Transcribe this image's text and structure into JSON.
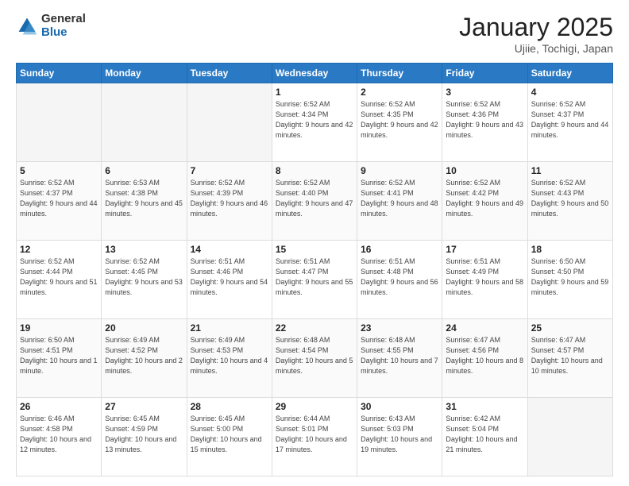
{
  "logo": {
    "general": "General",
    "blue": "Blue"
  },
  "header": {
    "month": "January 2025",
    "location": "Ujiie, Tochigi, Japan"
  },
  "weekdays": [
    "Sunday",
    "Monday",
    "Tuesday",
    "Wednesday",
    "Thursday",
    "Friday",
    "Saturday"
  ],
  "weeks": [
    [
      {
        "day": "",
        "info": ""
      },
      {
        "day": "",
        "info": ""
      },
      {
        "day": "",
        "info": ""
      },
      {
        "day": "1",
        "info": "Sunrise: 6:52 AM\nSunset: 4:34 PM\nDaylight: 9 hours and 42 minutes."
      },
      {
        "day": "2",
        "info": "Sunrise: 6:52 AM\nSunset: 4:35 PM\nDaylight: 9 hours and 42 minutes."
      },
      {
        "day": "3",
        "info": "Sunrise: 6:52 AM\nSunset: 4:36 PM\nDaylight: 9 hours and 43 minutes."
      },
      {
        "day": "4",
        "info": "Sunrise: 6:52 AM\nSunset: 4:37 PM\nDaylight: 9 hours and 44 minutes."
      }
    ],
    [
      {
        "day": "5",
        "info": "Sunrise: 6:52 AM\nSunset: 4:37 PM\nDaylight: 9 hours and 44 minutes."
      },
      {
        "day": "6",
        "info": "Sunrise: 6:53 AM\nSunset: 4:38 PM\nDaylight: 9 hours and 45 minutes."
      },
      {
        "day": "7",
        "info": "Sunrise: 6:52 AM\nSunset: 4:39 PM\nDaylight: 9 hours and 46 minutes."
      },
      {
        "day": "8",
        "info": "Sunrise: 6:52 AM\nSunset: 4:40 PM\nDaylight: 9 hours and 47 minutes."
      },
      {
        "day": "9",
        "info": "Sunrise: 6:52 AM\nSunset: 4:41 PM\nDaylight: 9 hours and 48 minutes."
      },
      {
        "day": "10",
        "info": "Sunrise: 6:52 AM\nSunset: 4:42 PM\nDaylight: 9 hours and 49 minutes."
      },
      {
        "day": "11",
        "info": "Sunrise: 6:52 AM\nSunset: 4:43 PM\nDaylight: 9 hours and 50 minutes."
      }
    ],
    [
      {
        "day": "12",
        "info": "Sunrise: 6:52 AM\nSunset: 4:44 PM\nDaylight: 9 hours and 51 minutes."
      },
      {
        "day": "13",
        "info": "Sunrise: 6:52 AM\nSunset: 4:45 PM\nDaylight: 9 hours and 53 minutes."
      },
      {
        "day": "14",
        "info": "Sunrise: 6:51 AM\nSunset: 4:46 PM\nDaylight: 9 hours and 54 minutes."
      },
      {
        "day": "15",
        "info": "Sunrise: 6:51 AM\nSunset: 4:47 PM\nDaylight: 9 hours and 55 minutes."
      },
      {
        "day": "16",
        "info": "Sunrise: 6:51 AM\nSunset: 4:48 PM\nDaylight: 9 hours and 56 minutes."
      },
      {
        "day": "17",
        "info": "Sunrise: 6:51 AM\nSunset: 4:49 PM\nDaylight: 9 hours and 58 minutes."
      },
      {
        "day": "18",
        "info": "Sunrise: 6:50 AM\nSunset: 4:50 PM\nDaylight: 9 hours and 59 minutes."
      }
    ],
    [
      {
        "day": "19",
        "info": "Sunrise: 6:50 AM\nSunset: 4:51 PM\nDaylight: 10 hours and 1 minute."
      },
      {
        "day": "20",
        "info": "Sunrise: 6:49 AM\nSunset: 4:52 PM\nDaylight: 10 hours and 2 minutes."
      },
      {
        "day": "21",
        "info": "Sunrise: 6:49 AM\nSunset: 4:53 PM\nDaylight: 10 hours and 4 minutes."
      },
      {
        "day": "22",
        "info": "Sunrise: 6:48 AM\nSunset: 4:54 PM\nDaylight: 10 hours and 5 minutes."
      },
      {
        "day": "23",
        "info": "Sunrise: 6:48 AM\nSunset: 4:55 PM\nDaylight: 10 hours and 7 minutes."
      },
      {
        "day": "24",
        "info": "Sunrise: 6:47 AM\nSunset: 4:56 PM\nDaylight: 10 hours and 8 minutes."
      },
      {
        "day": "25",
        "info": "Sunrise: 6:47 AM\nSunset: 4:57 PM\nDaylight: 10 hours and 10 minutes."
      }
    ],
    [
      {
        "day": "26",
        "info": "Sunrise: 6:46 AM\nSunset: 4:58 PM\nDaylight: 10 hours and 12 minutes."
      },
      {
        "day": "27",
        "info": "Sunrise: 6:45 AM\nSunset: 4:59 PM\nDaylight: 10 hours and 13 minutes."
      },
      {
        "day": "28",
        "info": "Sunrise: 6:45 AM\nSunset: 5:00 PM\nDaylight: 10 hours and 15 minutes."
      },
      {
        "day": "29",
        "info": "Sunrise: 6:44 AM\nSunset: 5:01 PM\nDaylight: 10 hours and 17 minutes."
      },
      {
        "day": "30",
        "info": "Sunrise: 6:43 AM\nSunset: 5:03 PM\nDaylight: 10 hours and 19 minutes."
      },
      {
        "day": "31",
        "info": "Sunrise: 6:42 AM\nSunset: 5:04 PM\nDaylight: 10 hours and 21 minutes."
      },
      {
        "day": "",
        "info": ""
      }
    ]
  ]
}
